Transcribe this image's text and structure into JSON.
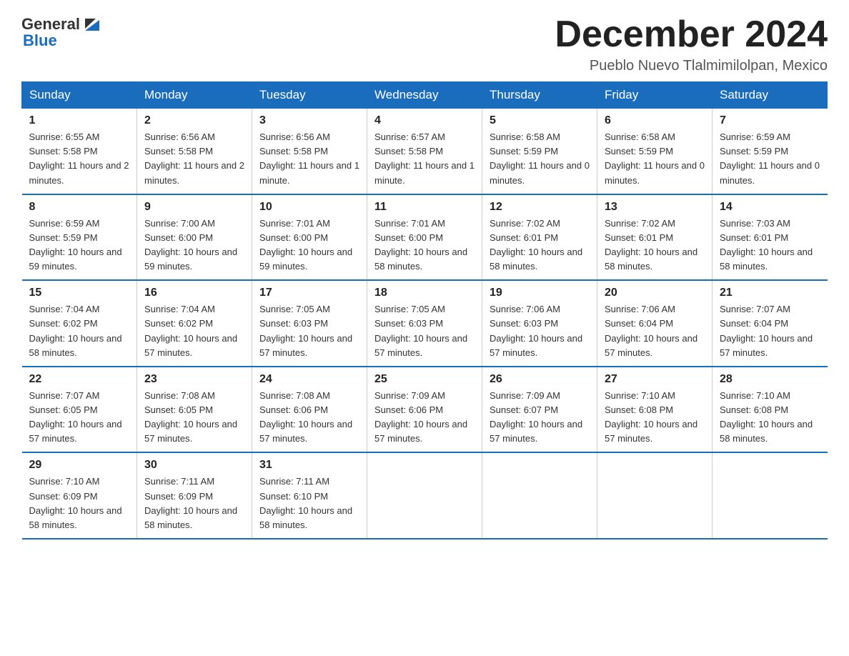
{
  "header": {
    "logo_general": "General",
    "logo_blue": "Blue",
    "title": "December 2024",
    "location": "Pueblo Nuevo Tlalmimilolpan, Mexico"
  },
  "days_of_week": [
    "Sunday",
    "Monday",
    "Tuesday",
    "Wednesday",
    "Thursday",
    "Friday",
    "Saturday"
  ],
  "weeks": [
    [
      {
        "day": "1",
        "sunrise": "6:55 AM",
        "sunset": "5:58 PM",
        "daylight": "11 hours and 2 minutes."
      },
      {
        "day": "2",
        "sunrise": "6:56 AM",
        "sunset": "5:58 PM",
        "daylight": "11 hours and 2 minutes."
      },
      {
        "day": "3",
        "sunrise": "6:56 AM",
        "sunset": "5:58 PM",
        "daylight": "11 hours and 1 minute."
      },
      {
        "day": "4",
        "sunrise": "6:57 AM",
        "sunset": "5:58 PM",
        "daylight": "11 hours and 1 minute."
      },
      {
        "day": "5",
        "sunrise": "6:58 AM",
        "sunset": "5:59 PM",
        "daylight": "11 hours and 0 minutes."
      },
      {
        "day": "6",
        "sunrise": "6:58 AM",
        "sunset": "5:59 PM",
        "daylight": "11 hours and 0 minutes."
      },
      {
        "day": "7",
        "sunrise": "6:59 AM",
        "sunset": "5:59 PM",
        "daylight": "11 hours and 0 minutes."
      }
    ],
    [
      {
        "day": "8",
        "sunrise": "6:59 AM",
        "sunset": "5:59 PM",
        "daylight": "10 hours and 59 minutes."
      },
      {
        "day": "9",
        "sunrise": "7:00 AM",
        "sunset": "6:00 PM",
        "daylight": "10 hours and 59 minutes."
      },
      {
        "day": "10",
        "sunrise": "7:01 AM",
        "sunset": "6:00 PM",
        "daylight": "10 hours and 59 minutes."
      },
      {
        "day": "11",
        "sunrise": "7:01 AM",
        "sunset": "6:00 PM",
        "daylight": "10 hours and 58 minutes."
      },
      {
        "day": "12",
        "sunrise": "7:02 AM",
        "sunset": "6:01 PM",
        "daylight": "10 hours and 58 minutes."
      },
      {
        "day": "13",
        "sunrise": "7:02 AM",
        "sunset": "6:01 PM",
        "daylight": "10 hours and 58 minutes."
      },
      {
        "day": "14",
        "sunrise": "7:03 AM",
        "sunset": "6:01 PM",
        "daylight": "10 hours and 58 minutes."
      }
    ],
    [
      {
        "day": "15",
        "sunrise": "7:04 AM",
        "sunset": "6:02 PM",
        "daylight": "10 hours and 58 minutes."
      },
      {
        "day": "16",
        "sunrise": "7:04 AM",
        "sunset": "6:02 PM",
        "daylight": "10 hours and 57 minutes."
      },
      {
        "day": "17",
        "sunrise": "7:05 AM",
        "sunset": "6:03 PM",
        "daylight": "10 hours and 57 minutes."
      },
      {
        "day": "18",
        "sunrise": "7:05 AM",
        "sunset": "6:03 PM",
        "daylight": "10 hours and 57 minutes."
      },
      {
        "day": "19",
        "sunrise": "7:06 AM",
        "sunset": "6:03 PM",
        "daylight": "10 hours and 57 minutes."
      },
      {
        "day": "20",
        "sunrise": "7:06 AM",
        "sunset": "6:04 PM",
        "daylight": "10 hours and 57 minutes."
      },
      {
        "day": "21",
        "sunrise": "7:07 AM",
        "sunset": "6:04 PM",
        "daylight": "10 hours and 57 minutes."
      }
    ],
    [
      {
        "day": "22",
        "sunrise": "7:07 AM",
        "sunset": "6:05 PM",
        "daylight": "10 hours and 57 minutes."
      },
      {
        "day": "23",
        "sunrise": "7:08 AM",
        "sunset": "6:05 PM",
        "daylight": "10 hours and 57 minutes."
      },
      {
        "day": "24",
        "sunrise": "7:08 AM",
        "sunset": "6:06 PM",
        "daylight": "10 hours and 57 minutes."
      },
      {
        "day": "25",
        "sunrise": "7:09 AM",
        "sunset": "6:06 PM",
        "daylight": "10 hours and 57 minutes."
      },
      {
        "day": "26",
        "sunrise": "7:09 AM",
        "sunset": "6:07 PM",
        "daylight": "10 hours and 57 minutes."
      },
      {
        "day": "27",
        "sunrise": "7:10 AM",
        "sunset": "6:08 PM",
        "daylight": "10 hours and 57 minutes."
      },
      {
        "day": "28",
        "sunrise": "7:10 AM",
        "sunset": "6:08 PM",
        "daylight": "10 hours and 58 minutes."
      }
    ],
    [
      {
        "day": "29",
        "sunrise": "7:10 AM",
        "sunset": "6:09 PM",
        "daylight": "10 hours and 58 minutes."
      },
      {
        "day": "30",
        "sunrise": "7:11 AM",
        "sunset": "6:09 PM",
        "daylight": "10 hours and 58 minutes."
      },
      {
        "day": "31",
        "sunrise": "7:11 AM",
        "sunset": "6:10 PM",
        "daylight": "10 hours and 58 minutes."
      },
      null,
      null,
      null,
      null
    ]
  ]
}
